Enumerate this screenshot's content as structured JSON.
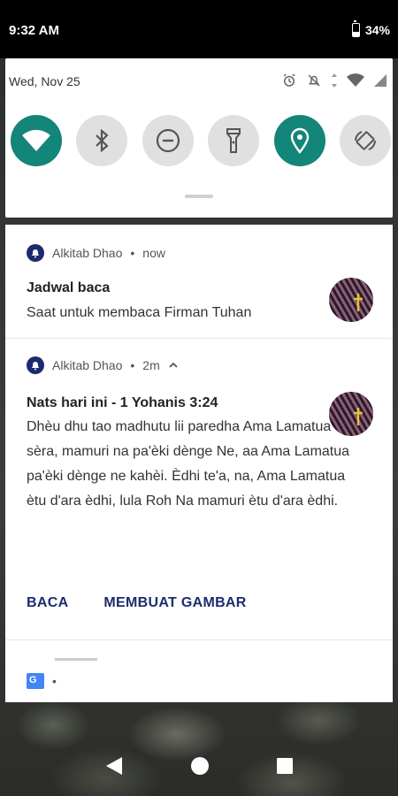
{
  "status_bar": {
    "time": "9:32 AM",
    "battery": "34%"
  },
  "quick_settings": {
    "date": "Wed, Nov 25",
    "tiles": [
      {
        "name": "wifi",
        "active": true
      },
      {
        "name": "bluetooth",
        "active": false
      },
      {
        "name": "do-not-disturb",
        "active": false
      },
      {
        "name": "flashlight",
        "active": false
      },
      {
        "name": "location",
        "active": true
      },
      {
        "name": "auto-rotate",
        "active": false
      }
    ],
    "accent_color": "#138579"
  },
  "notifications": [
    {
      "app": "Alkitab Dhao",
      "separator": "•",
      "time": "now",
      "title": "Jadwal baca",
      "text": "Saat untuk membaca Firman Tuhan"
    },
    {
      "app": "Alkitab Dhao",
      "separator": "•",
      "time": "2m",
      "title": "Nats hari ini - 1 Yohanis 3:24",
      "text": "Dhèu dhu tao madhutu lii paredha Ama Lamatua sèra, mamuri na pa'èki dènge Ne, aa Ama Lamatua pa'èki dènge ne kahèi. Èdhi te'a, na, Ama Lamatua ètu d'ara èdhi, lula Roh Na mamuri ètu d'ara èdhi.",
      "actions": [
        "BACA",
        "MEMBUAT GAMBAR"
      ]
    }
  ],
  "partial_notification": {
    "separator": "•",
    "icon": "translate-icon"
  },
  "colors": {
    "brand": "#1d2b6e",
    "action_text": "#1d2b6e"
  }
}
